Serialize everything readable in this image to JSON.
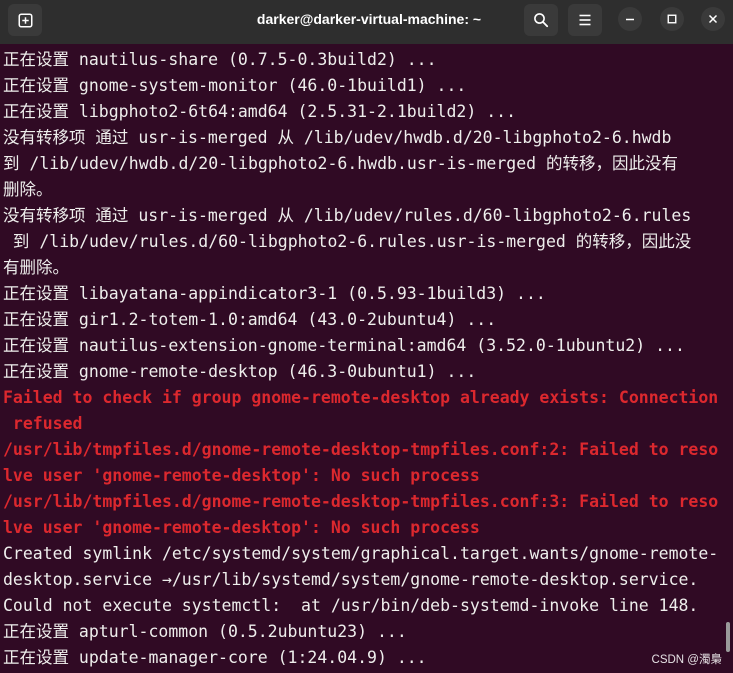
{
  "window": {
    "title": "darker@darker-virtual-machine: ~"
  },
  "header": {
    "icons": [
      "new-tab-icon",
      "search-icon",
      "menu-icon",
      "minimize-icon",
      "maximize-icon",
      "close-icon"
    ]
  },
  "terminal": {
    "lines": [
      {
        "text": "正在设置 nautilus-share (0.7.5-0.3build2) ..."
      },
      {
        "text": "正在设置 gnome-system-monitor (46.0-1build1) ..."
      },
      {
        "text": "正在设置 libgphoto2-6t64:amd64 (2.5.31-2.1build2) ..."
      },
      {
        "text": "没有转移项 通过 usr-is-merged 从 /lib/udev/hwdb.d/20-libgphoto2-6.hwdb"
      },
      {
        "text": "到 /lib/udev/hwdb.d/20-libgphoto2-6.hwdb.usr-is-merged 的转移，因此没有"
      },
      {
        "text": "删除。"
      },
      {
        "text": "没有转移项 通过 usr-is-merged 从 /lib/udev/rules.d/60-libgphoto2-6.rules"
      },
      {
        "text": " 到 /lib/udev/rules.d/60-libgphoto2-6.rules.usr-is-merged 的转移，因此没"
      },
      {
        "text": "有删除。"
      },
      {
        "text": "正在设置 libayatana-appindicator3-1 (0.5.93-1build3) ..."
      },
      {
        "text": "正在设置 gir1.2-totem-1.0:amd64 (43.0-2ubuntu4) ..."
      },
      {
        "text": "正在设置 nautilus-extension-gnome-terminal:amd64 (3.52.0-1ubuntu2) ..."
      },
      {
        "text": "正在设置 gnome-remote-desktop (46.3-0ubuntu1) ..."
      },
      {
        "text": "Failed to check if group gnome-remote-desktop already exists: Connection"
      },
      {
        "text": " refused"
      },
      {
        "text": "/usr/lib/tmpfiles.d/gnome-remote-desktop-tmpfiles.conf:2: Failed to reso"
      },
      {
        "text": "lve user 'gnome-remote-desktop': No such process"
      },
      {
        "text": "/usr/lib/tmpfiles.d/gnome-remote-desktop-tmpfiles.conf:3: Failed to reso"
      },
      {
        "text": "lve user 'gnome-remote-desktop': No such process"
      },
      {
        "text": "Created symlink /etc/systemd/system/graphical.target.wants/gnome-remote-"
      },
      {
        "text": "desktop.service →/usr/lib/systemd/system/gnome-remote-desktop.service."
      },
      {
        "text": "Could not execute systemctl:  at /usr/bin/deb-systemd-invoke line 148."
      },
      {
        "text": "正在设置 apturl-common (0.5.2ubuntu23) ..."
      },
      {
        "text": "正在设置 update-manager-core (1:24.04.9) ..."
      }
    ]
  },
  "watermark": "CSDN @濁梟",
  "colors": {
    "terminal_bg": "#300a24",
    "terminal_fg": "#eeeeec",
    "error_fg": "#dc282e",
    "headerbar_bg": "#2e2e2e",
    "button_bg": "#3a3a3a",
    "scrollbar_fg": "#9a9a9a"
  }
}
